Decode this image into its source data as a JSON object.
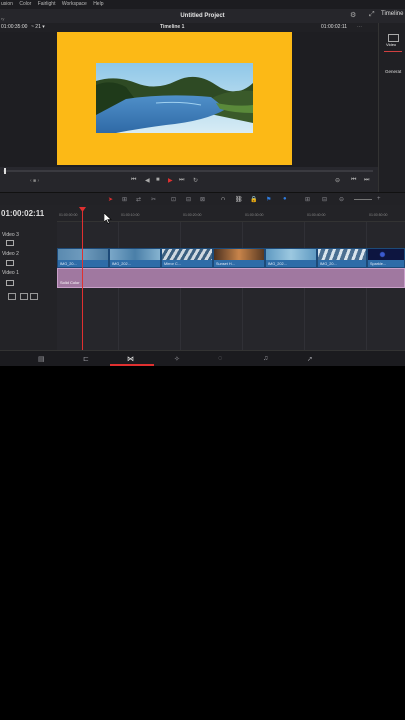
{
  "menu": [
    "usion",
    "Color",
    "Fairlight",
    "Workspace",
    "Help"
  ],
  "project_title": "Untitled Project",
  "left_timecode": "01:00:35:00",
  "zoom_label": "~ 21 ▾",
  "timeline_name": "Timeline 1",
  "right_timecode": "01:00:02:11",
  "panel": {
    "timeline_label": "Timeline",
    "video_label": "Video",
    "generators_label": "Generat",
    "side_label": "ry"
  },
  "timeline_timecode": "01:00:02:11",
  "ruler_ticks": [
    "01:00:00:00",
    "01:00:10:00",
    "01:00:20:00",
    "01:00:30:00",
    "01:00:40:00",
    "01:00:50:00"
  ],
  "tracks": {
    "v3": "Video 3",
    "v2": "Video 2",
    "v1": "Video 1"
  },
  "clips": [
    "IMG_20...",
    "IMG_202...",
    "Mirror C...",
    "Sunset H...",
    "IMG_202...",
    "IMG_20...",
    "Sparkle..."
  ],
  "solid_label": "Solid Color",
  "colors": {
    "frame": "#fcb916",
    "clip": "#2e6ca8",
    "solid": "#a078a0",
    "playhead": "#e03030",
    "accent": "#2f7de0"
  },
  "icons": [
    "media-icon",
    "cut-icon",
    "edit-icon",
    "fusion-icon",
    "color-icon",
    "fairlight-icon",
    "deliver-icon"
  ]
}
